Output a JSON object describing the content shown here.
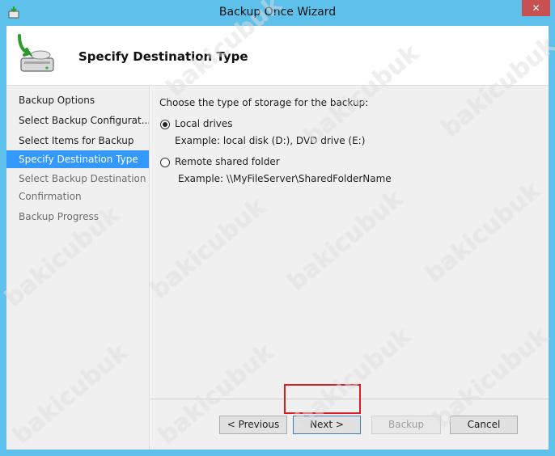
{
  "window": {
    "title": "Backup Once Wizard",
    "close_glyph": "✕"
  },
  "header": {
    "title": "Specify Destination Type",
    "icon": "backup-drive-icon"
  },
  "nav": {
    "items": [
      {
        "label": "Backup Options",
        "state": "done"
      },
      {
        "label": "Select Backup Configurat...",
        "state": "done"
      },
      {
        "label": "Select Items for Backup",
        "state": "done"
      },
      {
        "label": "Specify Destination Type",
        "state": "active"
      },
      {
        "label": "Select Backup Destination",
        "state": "disabled"
      },
      {
        "label": "Confirmation",
        "state": "disabled"
      },
      {
        "label": "Backup Progress",
        "state": "disabled"
      }
    ]
  },
  "content": {
    "prompt": "Choose the type of storage for the backup:",
    "options": [
      {
        "label": "Local drives",
        "example": "Example: local disk (D:), DVD drive (E:)",
        "selected": true
      },
      {
        "label": "Remote shared folder",
        "example": "Example: \\\\MyFileServer\\SharedFolderName",
        "selected": false
      }
    ]
  },
  "buttons": {
    "previous": "< Previous",
    "next": "Next >",
    "backup": "Backup",
    "cancel": "Cancel"
  },
  "watermark": "bakicubuk",
  "colors": {
    "selection": "#3399ff",
    "highlight_box": "#d81f26",
    "title_bar": "#5ec1ec"
  }
}
